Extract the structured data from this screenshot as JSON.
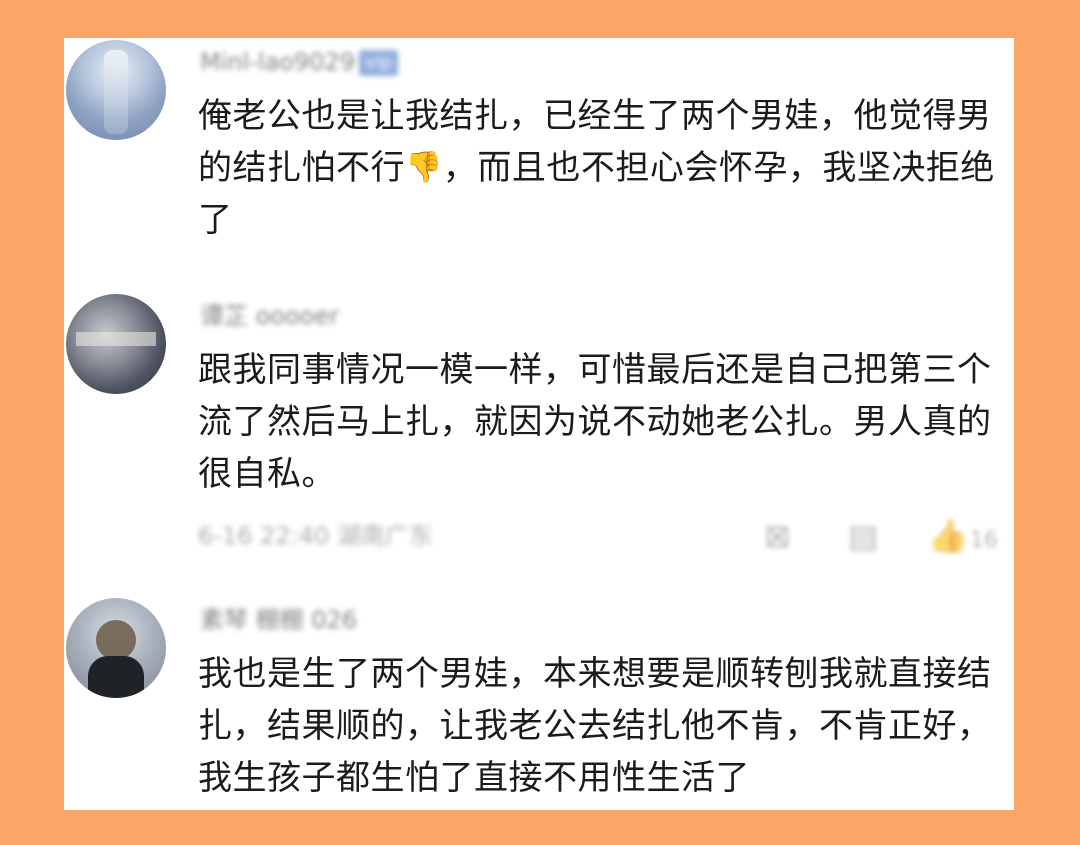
{
  "comments": [
    {
      "username": "Minl-lao9029",
      "badge": "vip",
      "avatar_icon": "blurred-avatar-icon",
      "text_part1": "俺老公也是让我结扎，已经生了两个男娃，他觉得男的结扎怕不行",
      "emoji": "👎",
      "text_part2": "，而且也不担心会怀孕，我坚决拒绝了"
    },
    {
      "username": "谭芷 ooooer",
      "avatar_icon": "blurred-avatar-icon",
      "text": "跟我同事情况一模一样，可惜最后还是自己把第三个流了然后马上扎，就因为说不动她老公扎。男人真的很自私。",
      "meta": {
        "time_location": "6-16 22:40 湖南广东",
        "share_icon": "share-icon",
        "reply_icon": "comment-icon",
        "like_icon": "thumbs-up-icon",
        "like_count": "16"
      }
    },
    {
      "username": "素琴 棚棚 026",
      "avatar_icon": "blurred-avatar-icon",
      "text": "我也是生了两个男娃，本来想要是顺转刨我就直接结扎，结果顺的，让我老公去结扎他不肯，不肯正好，我生孩子都生怕了直接不用性生活了"
    }
  ],
  "colors": {
    "frame_background": "#fba566",
    "card_background": "#ffffff",
    "text": "#1b1b1b"
  }
}
